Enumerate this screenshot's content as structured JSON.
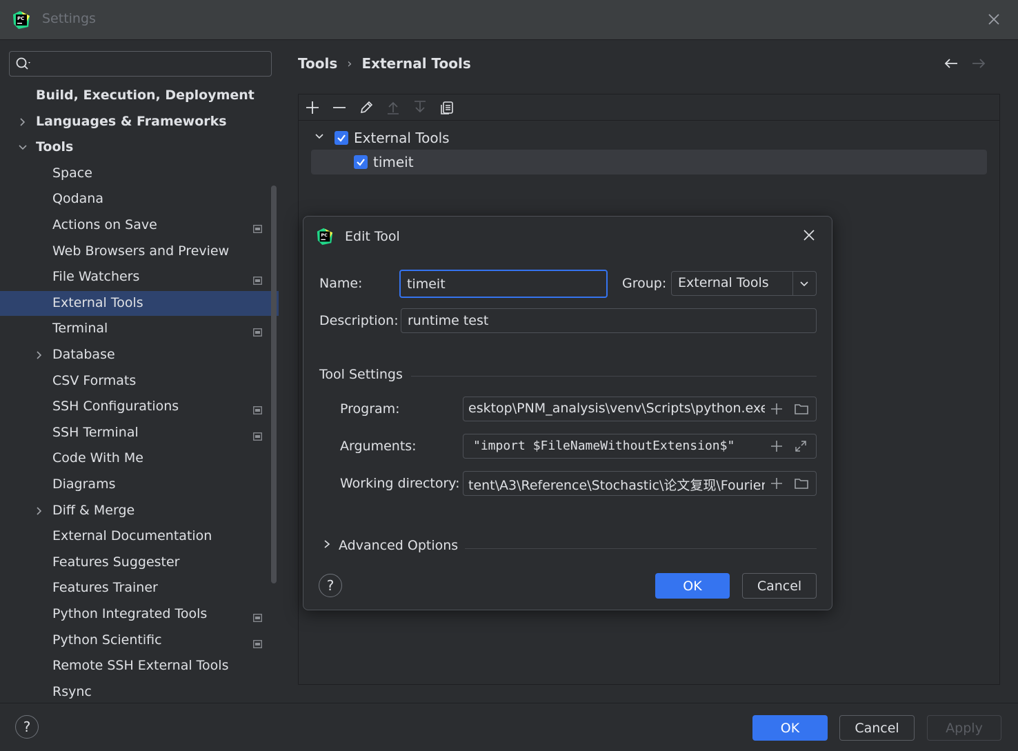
{
  "window": {
    "title": "Settings"
  },
  "search": {
    "placeholder": ""
  },
  "sidebar": {
    "items": [
      {
        "label": "Build, Execution, Deployment",
        "level": 0,
        "expander": "none",
        "indicator": false
      },
      {
        "label": "Languages & Frameworks",
        "level": 0,
        "expander": "collapsed",
        "indicator": false
      },
      {
        "label": "Tools",
        "level": 0,
        "expander": "expanded",
        "indicator": false
      },
      {
        "label": "Space",
        "level": 1,
        "expander": "none",
        "indicator": false
      },
      {
        "label": "Qodana",
        "level": 1,
        "expander": "none",
        "indicator": false
      },
      {
        "label": "Actions on Save",
        "level": 1,
        "expander": "none",
        "indicator": true
      },
      {
        "label": "Web Browsers and Preview",
        "level": 1,
        "expander": "none",
        "indicator": false
      },
      {
        "label": "File Watchers",
        "level": 1,
        "expander": "none",
        "indicator": true
      },
      {
        "label": "External Tools",
        "level": 1,
        "expander": "none",
        "indicator": false,
        "selected": true
      },
      {
        "label": "Terminal",
        "level": 1,
        "expander": "none",
        "indicator": true
      },
      {
        "label": "Database",
        "level": 1,
        "expander": "collapsed",
        "indicator": false
      },
      {
        "label": "CSV Formats",
        "level": 1,
        "expander": "none",
        "indicator": false
      },
      {
        "label": "SSH Configurations",
        "level": 1,
        "expander": "none",
        "indicator": true
      },
      {
        "label": "SSH Terminal",
        "level": 1,
        "expander": "none",
        "indicator": true
      },
      {
        "label": "Code With Me",
        "level": 1,
        "expander": "none",
        "indicator": false
      },
      {
        "label": "Diagrams",
        "level": 1,
        "expander": "none",
        "indicator": false
      },
      {
        "label": "Diff & Merge",
        "level": 1,
        "expander": "collapsed",
        "indicator": false
      },
      {
        "label": "External Documentation",
        "level": 1,
        "expander": "none",
        "indicator": false
      },
      {
        "label": "Features Suggester",
        "level": 1,
        "expander": "none",
        "indicator": false
      },
      {
        "label": "Features Trainer",
        "level": 1,
        "expander": "none",
        "indicator": false
      },
      {
        "label": "Python Integrated Tools",
        "level": 1,
        "expander": "none",
        "indicator": true
      },
      {
        "label": "Python Scientific",
        "level": 1,
        "expander": "none",
        "indicator": true
      },
      {
        "label": "Remote SSH External Tools",
        "level": 1,
        "expander": "none",
        "indicator": false
      },
      {
        "label": "Rsync",
        "level": 1,
        "expander": "none",
        "indicator": false
      }
    ]
  },
  "breadcrumb": {
    "parent": "Tools",
    "separator": "›",
    "current": "External Tools"
  },
  "tools_tree": {
    "group": {
      "label": "External Tools",
      "checked": true
    },
    "items": [
      {
        "label": "timeit",
        "checked": true
      }
    ]
  },
  "edit_tool": {
    "title": "Edit Tool",
    "name_label": "Name:",
    "name_value": "timeit",
    "group_label": "Group:",
    "group_value": "External Tools",
    "description_label": "Description:",
    "description_value": "runtime test",
    "tool_settings_title": "Tool Settings",
    "program_label": "Program:",
    "program_value": "esktop\\PNM_analysis\\venv\\Scripts\\python.exe",
    "arguments_label": "Arguments:",
    "arguments_value": "\"import $FileNameWithoutExtension$\"",
    "workdir_label": "Working directory:",
    "workdir_value": "tent\\A3\\Reference\\Stochastic\\论文复现\\Fourier",
    "advanced_label": "Advanced Options",
    "help_label": "?",
    "ok_label": "OK",
    "cancel_label": "Cancel"
  },
  "footer": {
    "help_label": "?",
    "ok_label": "OK",
    "cancel_label": "Cancel",
    "apply_label": "Apply"
  },
  "colors": {
    "accent": "#3574f0",
    "background": "#2b2d30",
    "titlebar": "#3c3f41",
    "selection": "#2e436e"
  }
}
